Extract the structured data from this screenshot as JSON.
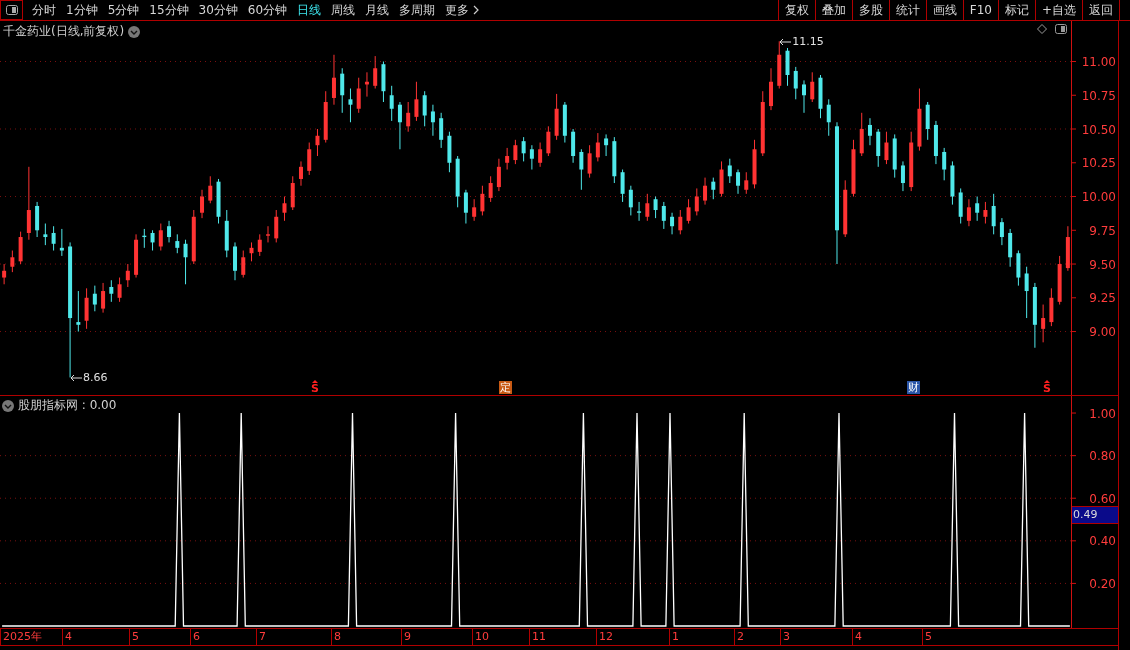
{
  "toolbar": {
    "tabs": [
      {
        "label": "分时",
        "selected": false
      },
      {
        "label": "1分钟",
        "selected": false
      },
      {
        "label": "5分钟",
        "selected": false
      },
      {
        "label": "15分钟",
        "selected": false
      },
      {
        "label": "30分钟",
        "selected": false
      },
      {
        "label": "60分钟",
        "selected": false
      },
      {
        "label": "日线",
        "selected": true
      },
      {
        "label": "周线",
        "selected": false
      },
      {
        "label": "月线",
        "selected": false
      },
      {
        "label": "多周期",
        "selected": false
      }
    ],
    "more_label": "更多",
    "buttons": [
      "复权",
      "叠加",
      "多股",
      "统计",
      "画线",
      "F10",
      "标记",
      "+自选",
      "返回"
    ]
  },
  "price_chart": {
    "title": "千金药业(日线,前复权)",
    "extremes": [
      {
        "kind": "high",
        "label": "11.15"
      },
      {
        "kind": "low",
        "label": "8.66"
      }
    ],
    "events": [
      {
        "kind": "s",
        "label": "S"
      },
      {
        "kind": "box",
        "label": "定",
        "color": "#c85a14"
      },
      {
        "kind": "box",
        "label": "财",
        "color": "#2a55a8"
      },
      {
        "kind": "s",
        "label": "S"
      }
    ],
    "chart_data": {
      "type": "candlestick",
      "ylim": [
        8.53,
        11.3
      ],
      "grid": true,
      "yticks": [
        {
          "value": 11,
          "label": "11.00"
        },
        {
          "value": 10.75,
          "label": "10.75"
        },
        {
          "value": 10.5,
          "label": "10.50"
        },
        {
          "value": 10.25,
          "label": "10.25"
        },
        {
          "value": 10,
          "label": "10.00"
        },
        {
          "value": 9.75,
          "label": "9.75"
        },
        {
          "value": 9.5,
          "label": "9.50"
        },
        {
          "value": 9.25,
          "label": "9.25"
        },
        {
          "value": 9,
          "label": "9.00"
        }
      ],
      "categories": [
        null,
        null,
        null,
        null,
        null,
        null,
        null,
        null,
        null,
        null,
        null,
        null,
        null,
        null,
        null,
        null,
        null,
        null,
        null,
        null,
        null,
        null,
        null,
        null,
        null,
        null,
        null,
        null,
        null,
        null,
        null,
        null,
        null,
        null,
        null,
        null,
        null,
        null,
        null,
        null,
        null,
        null,
        null,
        null,
        null,
        null,
        null,
        null,
        null,
        null,
        null,
        null,
        null,
        null,
        null,
        null,
        null,
        null,
        null,
        null,
        null,
        null,
        null,
        null,
        null,
        null,
        null,
        null,
        null,
        null,
        null,
        null,
        null,
        null,
        null,
        null,
        null,
        null,
        null,
        null,
        null,
        null,
        null,
        null,
        null,
        null,
        null,
        null,
        null,
        null,
        null,
        null,
        null,
        null,
        null,
        null,
        null,
        null,
        null,
        null,
        null,
        null,
        null,
        null,
        null,
        null,
        null,
        null,
        null,
        null,
        null,
        null,
        null,
        null,
        null,
        null,
        null,
        null,
        null,
        null,
        null,
        null,
        null,
        null,
        null,
        null,
        null,
        null,
        null,
        null
      ],
      "ohlc": [
        [
          9.4,
          9.5,
          9.35,
          9.45
        ],
        [
          9.48,
          9.6,
          9.44,
          9.55
        ],
        [
          9.52,
          9.74,
          9.5,
          9.7
        ],
        [
          9.73,
          10.22,
          9.68,
          9.9
        ],
        [
          9.93,
          9.96,
          9.7,
          9.75
        ],
        [
          9.72,
          9.8,
          9.64,
          9.7
        ],
        [
          9.73,
          9.78,
          9.6,
          9.65
        ],
        [
          9.62,
          9.76,
          9.56,
          9.6
        ],
        [
          9.63,
          9.66,
          8.66,
          9.1
        ],
        [
          9.07,
          9.3,
          9.0,
          9.05
        ],
        [
          9.08,
          9.32,
          9.02,
          9.25
        ],
        [
          9.28,
          9.34,
          9.15,
          9.2
        ],
        [
          9.17,
          9.36,
          9.14,
          9.3
        ],
        [
          9.33,
          9.38,
          9.22,
          9.28
        ],
        [
          9.25,
          9.4,
          9.22,
          9.35
        ],
        [
          9.38,
          9.5,
          9.33,
          9.45
        ],
        [
          9.42,
          9.72,
          9.4,
          9.68
        ],
        [
          9.71,
          9.76,
          9.62,
          9.7
        ],
        [
          9.73,
          9.75,
          9.6,
          9.66
        ],
        [
          9.63,
          9.8,
          9.6,
          9.75
        ],
        [
          9.78,
          9.82,
          9.66,
          9.7
        ],
        [
          9.67,
          9.72,
          9.58,
          9.62
        ],
        [
          9.65,
          9.68,
          9.35,
          9.55
        ],
        [
          9.52,
          9.9,
          9.5,
          9.85
        ],
        [
          9.88,
          10.05,
          9.84,
          10.0
        ],
        [
          9.97,
          10.15,
          9.95,
          10.08
        ],
        [
          10.11,
          10.13,
          9.8,
          9.85
        ],
        [
          9.82,
          9.9,
          9.55,
          9.6
        ],
        [
          9.63,
          9.66,
          9.38,
          9.45
        ],
        [
          9.42,
          9.6,
          9.4,
          9.55
        ],
        [
          9.58,
          9.66,
          9.52,
          9.62
        ],
        [
          9.59,
          9.72,
          9.56,
          9.68
        ],
        [
          9.71,
          9.78,
          9.66,
          9.72
        ],
        [
          9.69,
          9.9,
          9.66,
          9.85
        ],
        [
          9.88,
          10.0,
          9.82,
          9.95
        ],
        [
          9.92,
          10.15,
          9.9,
          10.1
        ],
        [
          10.13,
          10.26,
          10.08,
          10.22
        ],
        [
          10.19,
          10.4,
          10.16,
          10.35
        ],
        [
          10.38,
          10.5,
          10.3,
          10.45
        ],
        [
          10.42,
          10.78,
          10.4,
          10.7
        ],
        [
          10.73,
          11.05,
          10.68,
          10.88
        ],
        [
          10.91,
          10.95,
          10.62,
          10.75
        ],
        [
          10.72,
          10.8,
          10.55,
          10.68
        ],
        [
          10.65,
          10.88,
          10.62,
          10.8
        ],
        [
          10.83,
          10.92,
          10.74,
          10.85
        ],
        [
          10.82,
          11.04,
          10.8,
          10.95
        ],
        [
          10.98,
          11.0,
          10.7,
          10.78
        ],
        [
          10.75,
          10.82,
          10.56,
          10.65
        ],
        [
          10.68,
          10.7,
          10.35,
          10.55
        ],
        [
          10.52,
          10.7,
          10.48,
          10.62
        ],
        [
          10.59,
          10.85,
          10.56,
          10.72
        ],
        [
          10.75,
          10.78,
          10.52,
          10.6
        ],
        [
          10.63,
          10.68,
          10.45,
          10.55
        ],
        [
          10.58,
          10.62,
          10.36,
          10.42
        ],
        [
          10.45,
          10.48,
          10.18,
          10.25
        ],
        [
          10.28,
          10.3,
          9.92,
          10.0
        ],
        [
          10.03,
          10.05,
          9.8,
          9.88
        ],
        [
          9.85,
          9.98,
          9.82,
          9.92
        ],
        [
          9.89,
          10.08,
          9.86,
          10.02
        ],
        [
          9.99,
          10.15,
          9.96,
          10.1
        ],
        [
          10.07,
          10.28,
          10.04,
          10.22
        ],
        [
          10.25,
          10.36,
          10.2,
          10.3
        ],
        [
          10.27,
          10.42,
          10.24,
          10.38
        ],
        [
          10.41,
          10.44,
          10.26,
          10.32
        ],
        [
          10.35,
          10.38,
          10.2,
          10.28
        ],
        [
          10.25,
          10.4,
          10.22,
          10.35
        ],
        [
          10.32,
          10.52,
          10.3,
          10.48
        ],
        [
          10.45,
          10.76,
          10.42,
          10.65
        ],
        [
          10.68,
          10.7,
          10.4,
          10.45
        ],
        [
          10.48,
          10.5,
          10.25,
          10.3
        ],
        [
          10.33,
          10.35,
          10.05,
          10.2
        ],
        [
          10.17,
          10.38,
          10.14,
          10.32
        ],
        [
          10.29,
          10.47,
          10.26,
          10.4
        ],
        [
          10.43,
          10.46,
          10.3,
          10.38
        ],
        [
          10.41,
          10.44,
          10.1,
          10.15
        ],
        [
          10.18,
          10.2,
          9.96,
          10.02
        ],
        [
          10.05,
          10.08,
          9.86,
          9.92
        ],
        [
          9.89,
          9.96,
          9.82,
          9.88
        ],
        [
          9.85,
          10.02,
          9.82,
          9.95
        ],
        [
          9.98,
          10.0,
          9.84,
          9.9
        ],
        [
          9.93,
          9.96,
          9.76,
          9.82
        ],
        [
          9.85,
          9.88,
          9.72,
          9.78
        ],
        [
          9.75,
          9.9,
          9.72,
          9.85
        ],
        [
          9.82,
          9.98,
          9.8,
          9.92
        ],
        [
          9.89,
          10.06,
          9.86,
          10.0
        ],
        [
          9.97,
          10.14,
          9.94,
          10.08
        ],
        [
          10.11,
          10.14,
          9.98,
          10.05
        ],
        [
          10.02,
          10.26,
          10.0,
          10.2
        ],
        [
          10.23,
          10.28,
          10.1,
          10.15
        ],
        [
          10.18,
          10.2,
          10.02,
          10.08
        ],
        [
          10.05,
          10.18,
          10.02,
          10.12
        ],
        [
          10.09,
          10.42,
          10.06,
          10.35
        ],
        [
          10.32,
          10.78,
          10.3,
          10.7
        ],
        [
          10.67,
          10.95,
          10.64,
          10.85
        ],
        [
          10.82,
          11.15,
          10.8,
          11.05
        ],
        [
          11.08,
          11.1,
          10.82,
          10.9
        ],
        [
          10.93,
          10.96,
          10.72,
          10.8
        ],
        [
          10.83,
          10.86,
          10.62,
          10.75
        ],
        [
          10.72,
          10.92,
          10.7,
          10.85
        ],
        [
          10.88,
          10.9,
          10.58,
          10.65
        ],
        [
          10.68,
          10.72,
          10.45,
          10.55
        ],
        [
          10.52,
          10.55,
          9.5,
          9.75
        ],
        [
          9.72,
          10.12,
          9.7,
          10.05
        ],
        [
          10.02,
          10.42,
          10.0,
          10.35
        ],
        [
          10.32,
          10.62,
          10.3,
          10.5
        ],
        [
          10.53,
          10.58,
          10.38,
          10.45
        ],
        [
          10.48,
          10.5,
          10.22,
          10.3
        ],
        [
          10.27,
          10.48,
          10.24,
          10.4
        ],
        [
          10.43,
          10.46,
          10.14,
          10.2
        ],
        [
          10.23,
          10.26,
          10.04,
          10.1
        ],
        [
          10.07,
          10.48,
          10.04,
          10.4
        ],
        [
          10.37,
          10.8,
          10.34,
          10.65
        ],
        [
          10.68,
          10.7,
          10.42,
          10.5
        ],
        [
          10.53,
          10.56,
          10.24,
          10.3
        ],
        [
          10.33,
          10.36,
          10.12,
          10.2
        ],
        [
          10.23,
          10.26,
          9.94,
          10.0
        ],
        [
          10.03,
          10.06,
          9.8,
          9.85
        ],
        [
          9.82,
          9.98,
          9.78,
          9.92
        ],
        [
          9.95,
          10.0,
          9.82,
          9.88
        ],
        [
          9.85,
          9.96,
          9.8,
          9.9
        ],
        [
          9.93,
          10.02,
          9.72,
          9.78
        ],
        [
          9.81,
          9.84,
          9.64,
          9.7
        ],
        [
          9.73,
          9.76,
          9.48,
          9.55
        ],
        [
          9.58,
          9.6,
          9.34,
          9.4
        ],
        [
          9.43,
          9.48,
          9.1,
          9.3
        ],
        [
          9.33,
          9.36,
          8.88,
          9.05
        ],
        [
          9.02,
          9.2,
          8.92,
          9.1
        ],
        [
          9.07,
          9.32,
          9.04,
          9.25
        ],
        [
          9.22,
          9.56,
          9.2,
          9.5
        ],
        [
          9.47,
          9.78,
          9.45,
          9.7
        ]
      ]
    }
  },
  "indicator": {
    "readout": ": 0.00",
    "cursor_value": "0.49",
    "chart_data": {
      "type": "line",
      "ylim": [
        0,
        1.08
      ],
      "grid": true,
      "yticks": [
        {
          "value": 0.2,
          "label": "0.20"
        },
        {
          "value": 0.4,
          "label": "0.40"
        },
        {
          "value": 0.6,
          "label": "0.60"
        },
        {
          "value": 0.8,
          "label": "0.80"
        },
        {
          "value": 1,
          "label": "1.00"
        }
      ],
      "categories": [
        null,
        null,
        null,
        null,
        null,
        null,
        null,
        null,
        null,
        null,
        null,
        null,
        null,
        null,
        null,
        null,
        null,
        null,
        null,
        null,
        null,
        null,
        null,
        null,
        null,
        null,
        null,
        null,
        null,
        null,
        null,
        null,
        null,
        null,
        null,
        null,
        null,
        null,
        null,
        null,
        null,
        null,
        null,
        null,
        null,
        null,
        null,
        null,
        null,
        null,
        null,
        null,
        null,
        null,
        null,
        null,
        null,
        null,
        null,
        null,
        null,
        null,
        null,
        null,
        null,
        null,
        null,
        null,
        null,
        null,
        null,
        null,
        null,
        null,
        null,
        null,
        null,
        null,
        null,
        null,
        null,
        null,
        null,
        null,
        null,
        null,
        null,
        null,
        null,
        null,
        null,
        null,
        null,
        null,
        null,
        null,
        null,
        null,
        null,
        null,
        null,
        null,
        null,
        null,
        null,
        null,
        null,
        null,
        null,
        null,
        null,
        null,
        null,
        null,
        null,
        null,
        null,
        null,
        null,
        null,
        null,
        null,
        null,
        null,
        null,
        null,
        null,
        null,
        null,
        null,
        null,
        null,
        null,
        null,
        null,
        null,
        null,
        null,
        null,
        null,
        null,
        null,
        null,
        null,
        null,
        null,
        null,
        null,
        null,
        null,
        null,
        null,
        null,
        null,
        null,
        null,
        null,
        null,
        null,
        null,
        null,
        null,
        null,
        null,
        null,
        null,
        null,
        null,
        null,
        null,
        null,
        null,
        null,
        null,
        null,
        null,
        null,
        null,
        null,
        null,
        null,
        null,
        null,
        null,
        null,
        null,
        null,
        null,
        null,
        null,
        null,
        null,
        null,
        null,
        null,
        null,
        null,
        null,
        null,
        null,
        null,
        null,
        null,
        null,
        null,
        null,
        null,
        null,
        null,
        null,
        null,
        null,
        null,
        null,
        null,
        null,
        null,
        null,
        null,
        null,
        null,
        null,
        null,
        null,
        null,
        null,
        null,
        null,
        null,
        null,
        null,
        null,
        null,
        null,
        null,
        null,
        null,
        null,
        null,
        null,
        null,
        null,
        null,
        null,
        null,
        null,
        null,
        null,
        null,
        null,
        null,
        null,
        null,
        null,
        null,
        null,
        null,
        null,
        null,
        null
      ],
      "series": [
        {
          "name": "股朋指标网",
          "color": "#ffffff",
          "values": [
            0,
            0,
            0,
            0,
            0,
            0,
            0,
            0,
            0,
            0,
            0,
            0,
            0,
            0,
            0,
            0,
            0,
            0,
            0,
            0,
            0,
            0,
            0,
            0,
            0,
            0,
            0,
            0,
            0,
            0,
            0,
            0,
            0,
            0,
            0,
            0,
            0,
            0,
            0,
            0,
            0,
            0,
            0,
            1,
            0,
            0,
            0,
            0,
            0,
            0,
            0,
            0,
            0,
            0,
            0,
            0,
            0,
            0,
            1,
            0,
            0,
            0,
            0,
            0,
            0,
            0,
            0,
            0,
            0,
            0,
            0,
            0,
            0,
            0,
            0,
            0,
            0,
            0,
            0,
            0,
            0,
            0,
            0,
            0,
            0,
            1,
            0,
            0,
            0,
            0,
            0,
            0,
            0,
            0,
            0,
            0,
            0,
            0,
            0,
            0,
            0,
            0,
            0,
            0,
            0,
            0,
            0,
            0,
            0,
            0,
            1,
            0,
            0,
            0,
            0,
            0,
            0,
            0,
            0,
            0,
            0,
            0,
            0,
            0,
            0,
            0,
            0,
            0,
            0,
            0,
            0,
            0,
            0,
            0,
            0,
            0,
            0,
            0,
            0,
            0,
            0,
            1,
            0,
            0,
            0,
            0,
            0,
            0,
            0,
            0,
            0,
            0,
            0,
            0,
            1,
            0,
            0,
            0,
            0,
            0,
            0,
            0,
            1,
            0,
            0,
            0,
            0,
            0,
            0,
            0,
            0,
            0,
            0,
            0,
            0,
            0,
            0,
            0,
            0,
            0,
            1,
            0,
            0,
            0,
            0,
            0,
            0,
            0,
            0,
            0,
            0,
            0,
            0,
            0,
            0,
            0,
            0,
            0,
            0,
            0,
            0,
            0,
            0,
            1,
            0,
            0,
            0,
            0,
            0,
            0,
            0,
            0,
            0,
            0,
            0,
            0,
            0,
            0,
            0,
            0,
            0,
            0,
            0,
            0,
            0,
            0,
            0,
            0,
            0,
            0,
            0,
            1,
            0,
            0,
            0,
            0,
            0,
            0,
            0,
            0,
            0,
            0,
            0,
            0,
            0,
            0,
            0,
            0,
            1,
            0,
            0,
            0,
            0,
            0,
            0,
            0,
            0,
            0,
            0,
            0
          ]
        }
      ]
    }
  },
  "time_axis": [
    "2025年",
    "4",
    "5",
    "6",
    "7",
    "8",
    "9",
    "10",
    "11",
    "12",
    "1",
    "2",
    "3",
    "4",
    "5"
  ]
}
